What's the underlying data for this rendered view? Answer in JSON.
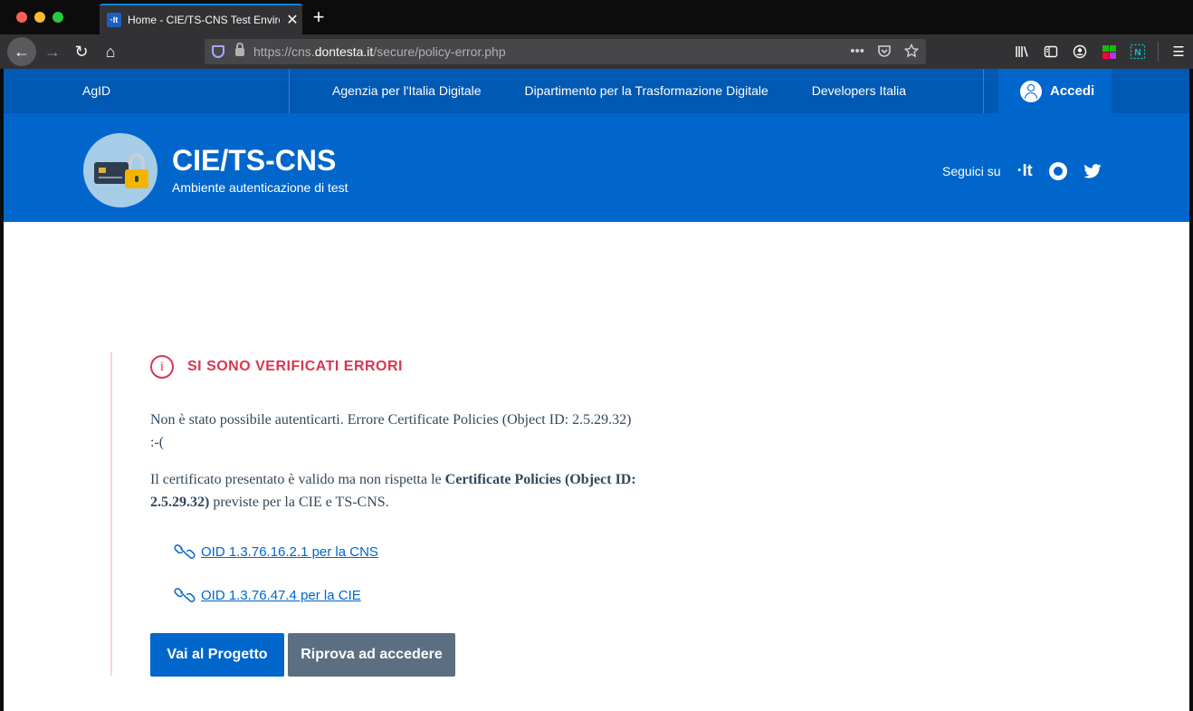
{
  "browser": {
    "tab_title": "Home - CIE/TS-CNS Test Environment",
    "tab_favicon": "·It",
    "tab_close": "✕",
    "new_tab": "+",
    "url_prefix": "https://cns.",
    "url_host": "dontesta.it",
    "url_path": "/secure/policy-error.php",
    "back": "←",
    "forward": "→",
    "reload": "↻",
    "home": "⌂",
    "page_actions": "•••",
    "menu": "☰"
  },
  "slim_header": {
    "owner": "AgID",
    "links": [
      "Agenzia per l'Italia Digitale",
      "Dipartimento per la Trasformazione Digitale",
      "Developers Italia"
    ],
    "login_label": "Accedi"
  },
  "header": {
    "title": "CIE/TS-CNS",
    "subtitle": "Ambiente autenticazione di test",
    "follow_label": "Seguici su",
    "social_it": "·It"
  },
  "error": {
    "heading": "SI SONO VERIFICATI ERRORI",
    "info_glyph": "i",
    "message": "Non è stato possibile autenticarti. Errore Certificate Policies (Object ID: 2.5.29.32) :-(",
    "detail_pre": "Il certificato presentato è valido ma non rispetta le ",
    "detail_bold": "Certificate Policies (Object ID: 2.5.29.32)",
    "detail_post": " previste per la CIE e TS-CNS.",
    "links": [
      " OID 1.3.76.16.2.1 per la CNS",
      " OID 1.3.76.47.4 per la CIE"
    ],
    "btn_project": "Vai al Progetto",
    "btn_retry": "Riprova ad accedere"
  },
  "colors": {
    "slim_bg": "#0059b3",
    "header_bg": "#0066cc",
    "error_red": "#d9364f",
    "secondary_btn": "#5c6f82"
  }
}
